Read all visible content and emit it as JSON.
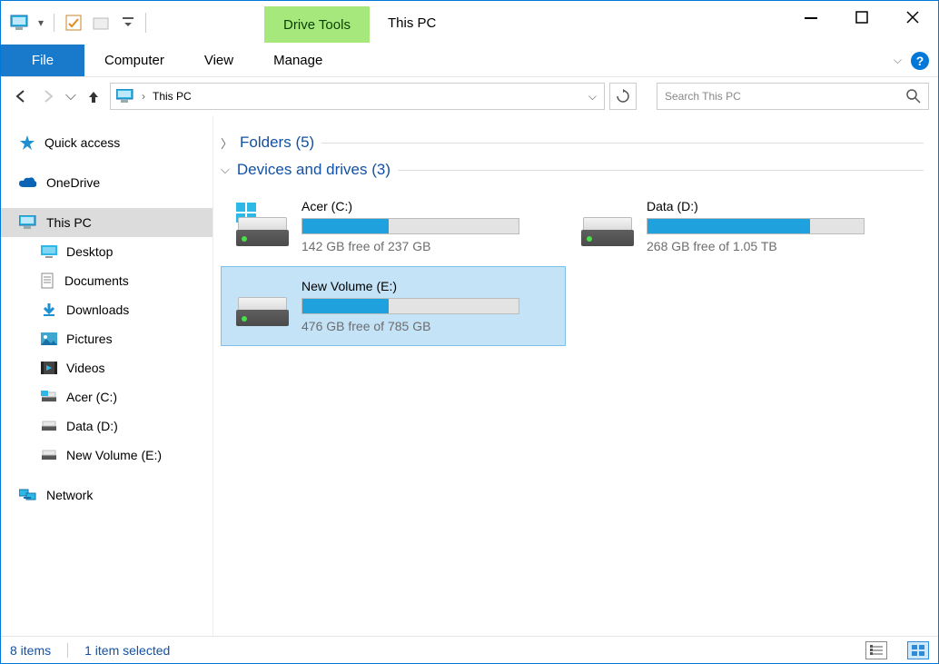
{
  "window": {
    "title": "This PC"
  },
  "context_tab": {
    "group": "Drive Tools",
    "tab": "Manage"
  },
  "ribbon": {
    "file": "File",
    "tabs": [
      "Computer",
      "View"
    ]
  },
  "nav": {
    "breadcrumb": "This PC",
    "search_placeholder": "Search This PC"
  },
  "sidebar": {
    "quick_access": "Quick access",
    "onedrive": "OneDrive",
    "this_pc": "This PC",
    "children": [
      "Desktop",
      "Documents",
      "Downloads",
      "Pictures",
      "Videos",
      "Acer (C:)",
      "Data (D:)",
      "New Volume (E:)"
    ],
    "network": "Network"
  },
  "groups": {
    "folders": {
      "label": "Folders",
      "count": "(5)",
      "expanded": false
    },
    "drives": {
      "label": "Devices and drives",
      "count": "(3)",
      "expanded": true
    }
  },
  "drives": [
    {
      "name": "Acer (C:)",
      "free_text": "142 GB free of 237 GB",
      "fill_pct": 40,
      "is_os": true,
      "selected": false
    },
    {
      "name": "Data (D:)",
      "free_text": "268 GB free of 1.05 TB",
      "fill_pct": 75,
      "is_os": false,
      "selected": false
    },
    {
      "name": "New Volume (E:)",
      "free_text": "476 GB free of 785 GB",
      "fill_pct": 40,
      "is_os": false,
      "selected": true
    }
  ],
  "status": {
    "items": "8 items",
    "selection": "1 item selected"
  }
}
